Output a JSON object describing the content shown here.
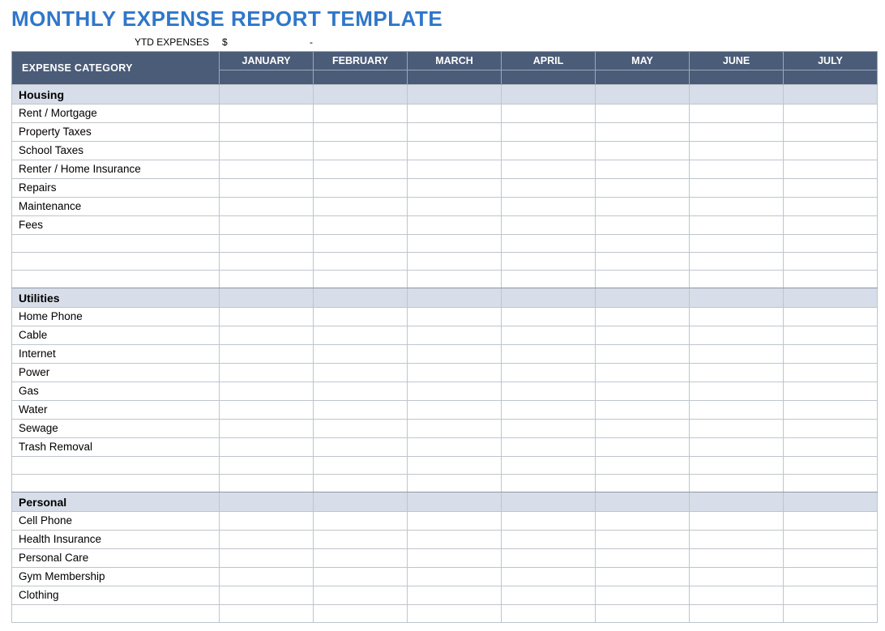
{
  "title": "MONTHLY EXPENSE REPORT TEMPLATE",
  "ytd": {
    "label": "YTD EXPENSES",
    "currency": "$",
    "value": "-"
  },
  "header": {
    "category": "EXPENSE CATEGORY",
    "months": [
      "JANUARY",
      "FEBRUARY",
      "MARCH",
      "APRIL",
      "MAY",
      "JUNE",
      "JULY"
    ]
  },
  "sections": [
    {
      "name": "Housing",
      "rows": [
        "Rent / Mortgage",
        "Property Taxes",
        "School Taxes",
        "Renter / Home Insurance",
        "Repairs",
        "Maintenance",
        "Fees",
        "",
        "",
        ""
      ]
    },
    {
      "name": "Utilities",
      "rows": [
        "Home Phone",
        "Cable",
        "Internet",
        "Power",
        "Gas",
        "Water",
        "Sewage",
        "Trash Removal",
        "",
        ""
      ]
    },
    {
      "name": "Personal",
      "rows": [
        "Cell Phone",
        "Health Insurance",
        "Personal Care",
        "Gym Membership",
        "Clothing",
        ""
      ]
    }
  ]
}
